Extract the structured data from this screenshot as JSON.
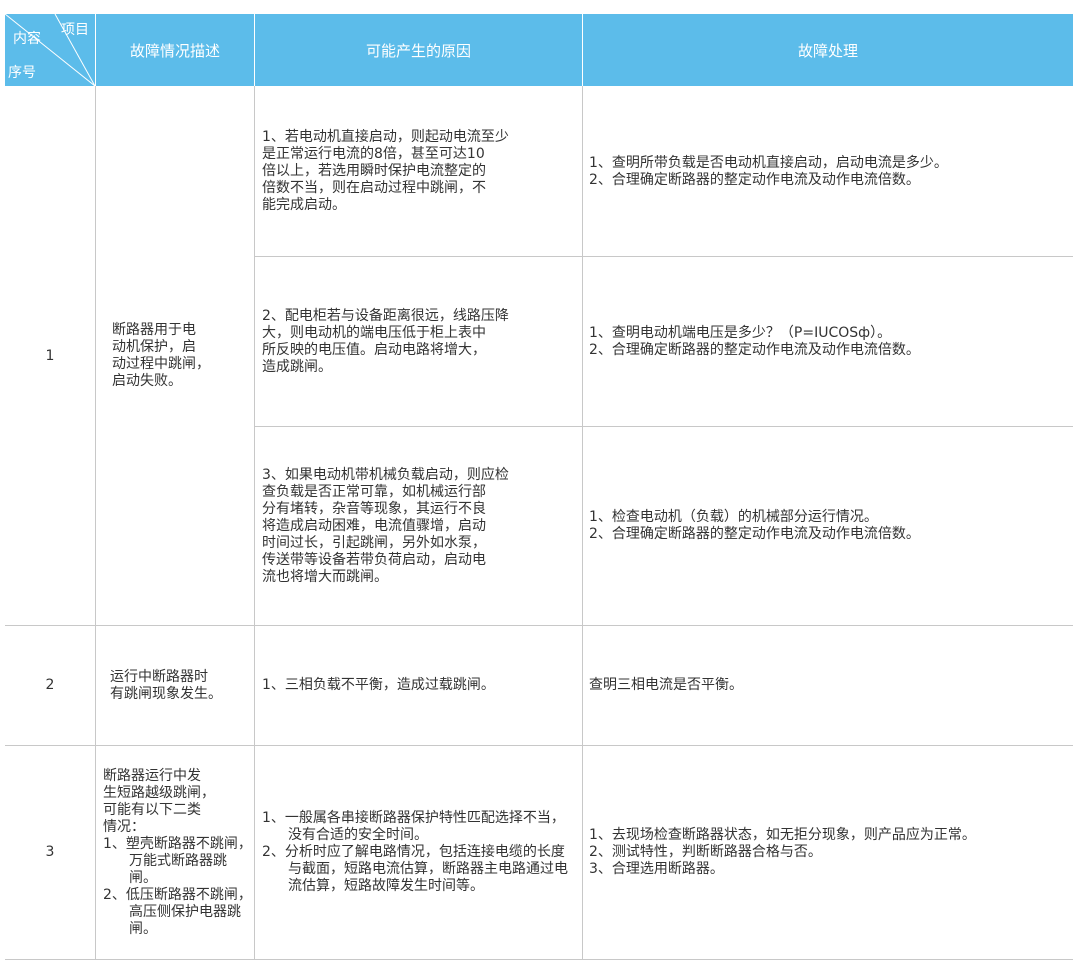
{
  "header": {
    "corner_item": "项目",
    "corner_content": "内容",
    "corner_seq": "序号",
    "desc": "故障情况描述",
    "cause": "可能产生的原因",
    "fix": "故障处理"
  },
  "rows": [
    {
      "seq": "1",
      "desc": "断路器用于电\n动机保护，启\n动过程中跳闸，\n启动失败。",
      "subs": [
        {
          "cause": "1、若电动机直接启动，则起动电流至少\n是正常运行电流的8倍，甚至可达10\n倍以上，若选用瞬时保护电流整定的\n倍数不当，则在启动过程中跳闸，不\n能完成启动。",
          "fix": "1、查明所带负载是否电动机直接启动，启动电流是多少。\n2、合理确定断路器的整定动作电流及动作电流倍数。"
        },
        {
          "cause": "2、配电柜若与设备距离很远，线路压降\n大，则电动机的端电压低于柜上表中\n所反映的电压值。启动电路将增大，\n造成跳闸。",
          "fix": "1、查明电动机端电压是多少？（P=IUCOSф）。\n2、合理确定断路器的整定动作电流及动作电流倍数。"
        },
        {
          "cause": "3、如果电动机带机械负载启动，则应检\n查负载是否正常可靠，如机械运行部\n分有堵转，杂音等现象，其运行不良\n将造成启动困难，电流值骤增，启动\n时间过长，引起跳闸，另外如水泵，\n传送带等设备若带负荷启动，启动电\n流也将增大而跳闸。",
          "fix": "1、检查电动机（负载）的机械部分运行情况。\n2、合理确定断路器的整定动作电流及动作电流倍数。"
        }
      ]
    },
    {
      "seq": "2",
      "desc": "运行中断路器时\n有跳闸现象发生。",
      "cause": "1、三相负载不平衡，造成过载跳闸。",
      "fix": "查明三相电流是否平衡。"
    },
    {
      "seq": "3",
      "desc_intro": "断路器运行中发\n生短路越级跳闸，\n可能有以下二类\n情况：",
      "desc_items": [
        "1、塑壳断路器不跳闸，万能式断路器跳闸。",
        "2、低压断路器不跳闸，高压侧保护电器跳闸。"
      ],
      "cause_items": [
        "1、一般属各串接断路器保护特性匹配选择不当，没有合适的安全时间。",
        "2、分析时应了解电路情况，包括连接电缆的长度与截面，短路电流估算，断路器主电路通过电流估算，短路故障发生时间等。"
      ],
      "fix_items": [
        "1、去现场检查断路器状态，如无拒分现象，则产品应为正常。",
        "2、测试特性，判断断路器合格与否。",
        "3、合理选用断路器。"
      ]
    }
  ]
}
